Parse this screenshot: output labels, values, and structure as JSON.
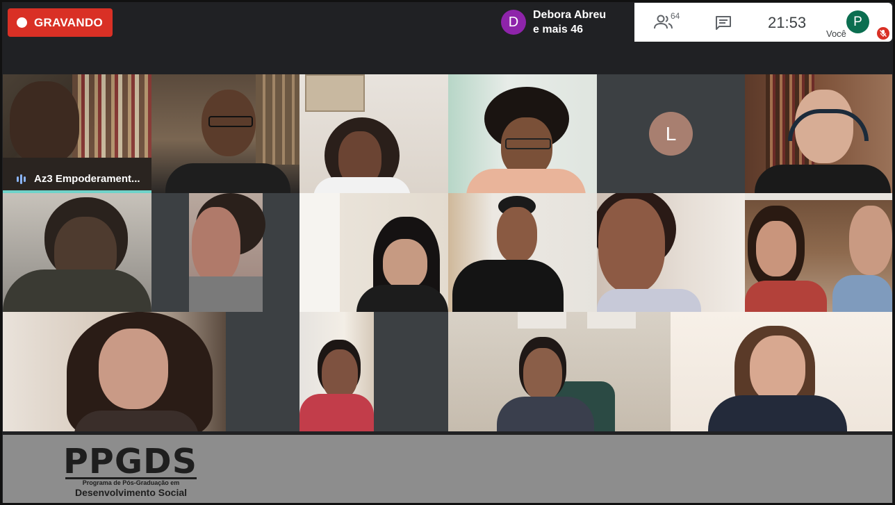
{
  "recording": {
    "label": "GRAVANDO"
  },
  "active_speaker": {
    "initial": "D",
    "name": "Debora Abreu",
    "others": "e mais 46"
  },
  "toolbar": {
    "people_count": "64",
    "time": "21:53",
    "self_initial": "P",
    "self_label": "Você"
  },
  "tiles": [
    {
      "kind": "video",
      "name": "Az3 Empoderament..."
    },
    {
      "kind": "video"
    },
    {
      "kind": "video"
    },
    {
      "kind": "video"
    },
    {
      "kind": "avatar",
      "initial": "L"
    },
    {
      "kind": "video"
    },
    {
      "kind": "video"
    },
    {
      "kind": "video"
    },
    {
      "kind": "video"
    },
    {
      "kind": "video"
    },
    {
      "kind": "video"
    },
    {
      "kind": "video"
    },
    {
      "kind": "video"
    },
    {
      "kind": "video"
    },
    {
      "kind": "video"
    },
    {
      "kind": "video"
    }
  ],
  "footer": {
    "logo": "PPGDS",
    "subtitle": "Programa de Pós-Graduação em",
    "subtitle2": "Desenvolvimento Social"
  },
  "colors": {
    "record": "#d93025",
    "speaker_avatar": "#8e24aa",
    "self_avatar": "#0b6e50",
    "highlight": "#6fd3c9"
  }
}
